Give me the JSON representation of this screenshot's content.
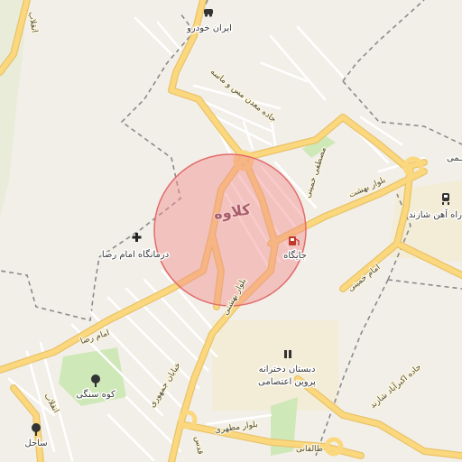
{
  "map": {
    "area_label": "کلاوه",
    "places": {
      "iran_khodro": "ایران خودرو",
      "hospital": "درمانگاه امام رضا",
      "fuel": "جایگاه",
      "school_1": "دبستان دخترانه",
      "school_2": "پروین اعتصامی",
      "park": "کوه سنگی",
      "sahel": "ساحل",
      "station": "راه آهن شازند",
      "edge_label": "ـمی"
    },
    "roads": {
      "madan": "جاده معدن مس و ماسه",
      "mostafa": "مصطفی خمینی",
      "behesht_1": "بلوار بهشت",
      "behesht_2": "بلوار بهشتی",
      "imam_reza": "امام رضا",
      "khiaban_jomhouri": "خیابان جمهوری",
      "imam_khomeini": "امام خمینی",
      "motahari": "بلوار مطهری",
      "akbarabad": "جاده اکبرآباد شازند",
      "taleghani": "طالقانی",
      "enghelab_top": "انقلاب",
      "enghelab_bottom": "انقلاب",
      "ghods": "قدس"
    },
    "colors": {
      "background": "#f2efe9",
      "major_road": "#fbd77e",
      "major_road_casing": "#e9c36a",
      "minor_road": "#ffffff",
      "boundary": "#8a8a8a",
      "highlight_fill": "#f28b8b",
      "highlight_stroke": "#e26d6d",
      "park": "#cfe8b8",
      "school_area": "#f3ecd6"
    },
    "icons": [
      "car-icon",
      "hospital-cross-icon",
      "fuel-icon",
      "school-icon",
      "tree-icon",
      "train-icon"
    ]
  }
}
